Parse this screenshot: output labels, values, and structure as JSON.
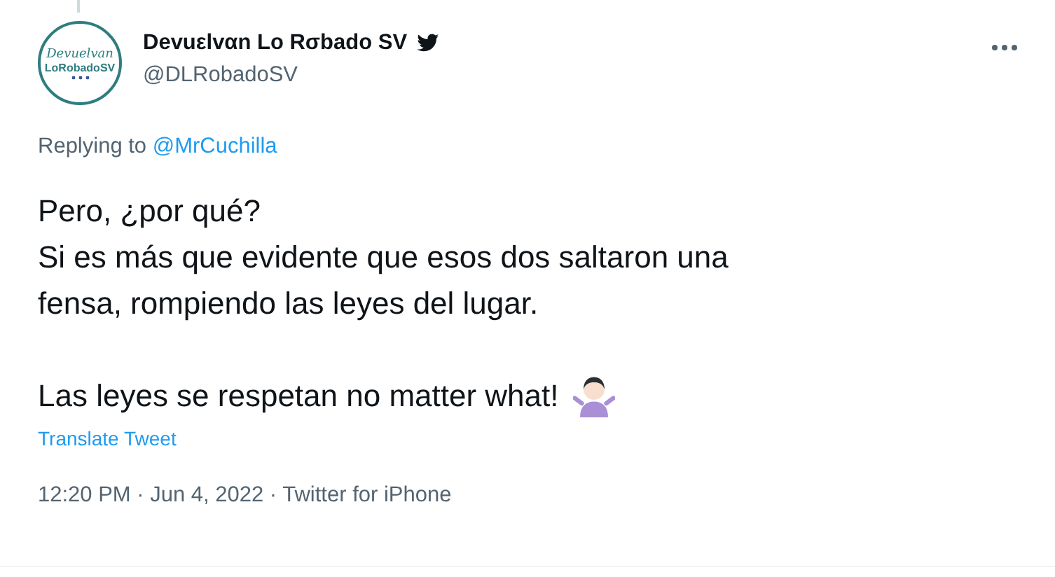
{
  "author": {
    "name": "Devuεlvαn Lo Rσbado SV",
    "verified_bird": true,
    "handle": "@DLRobadoSV",
    "avatar_text": [
      "Devuelvan",
      "LoRobadoSV"
    ]
  },
  "replying": {
    "prefix": "Replying to ",
    "mention": "@MrCuchilla"
  },
  "body": [
    "Pero, ¿por qué?\nSi es más que evidente que esos dos saltaron una\nfensa, rompiendo las leyes del lugar.",
    "Las leyes se respetan no matter what!"
  ],
  "translate": "Translate Tweet",
  "meta": "12:20 PM · Jun 4, 2022 · Twitter for iPhone"
}
